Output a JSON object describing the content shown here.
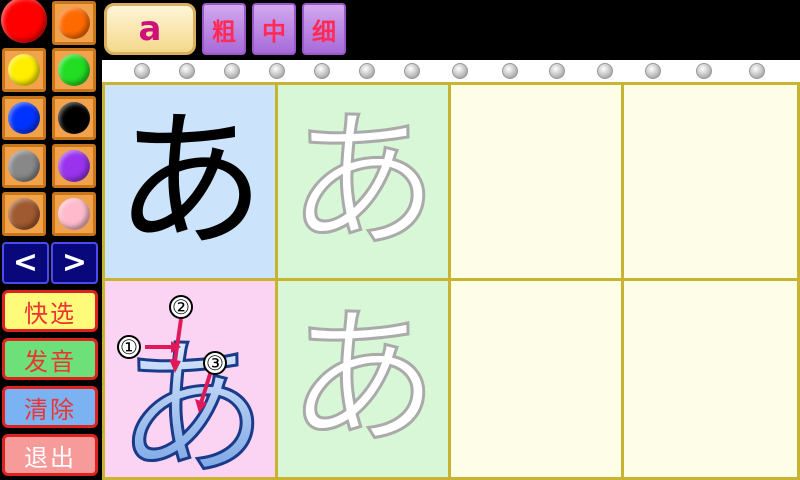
{
  "palette": {
    "colors": [
      "#ff0000",
      "#ff6a00",
      "#ffee00",
      "#22dd22",
      "#0033ff",
      "#000000",
      "#888888",
      "#9933ee",
      "#a05a30",
      "#ffbbcc"
    ],
    "prev_label": "<",
    "next_label": ">"
  },
  "side_buttons": {
    "quick": "快选",
    "sound": "发音",
    "clear": "清除",
    "exit": "退出"
  },
  "toolbar": {
    "letter": "a",
    "thick": "粗",
    "medium": "中",
    "thin": "细"
  },
  "grid": {
    "sample_char": "あ",
    "trace_char": "あ",
    "stroke_guide_char": "あ",
    "stroke_numbers": [
      "①",
      "②",
      "③"
    ]
  }
}
